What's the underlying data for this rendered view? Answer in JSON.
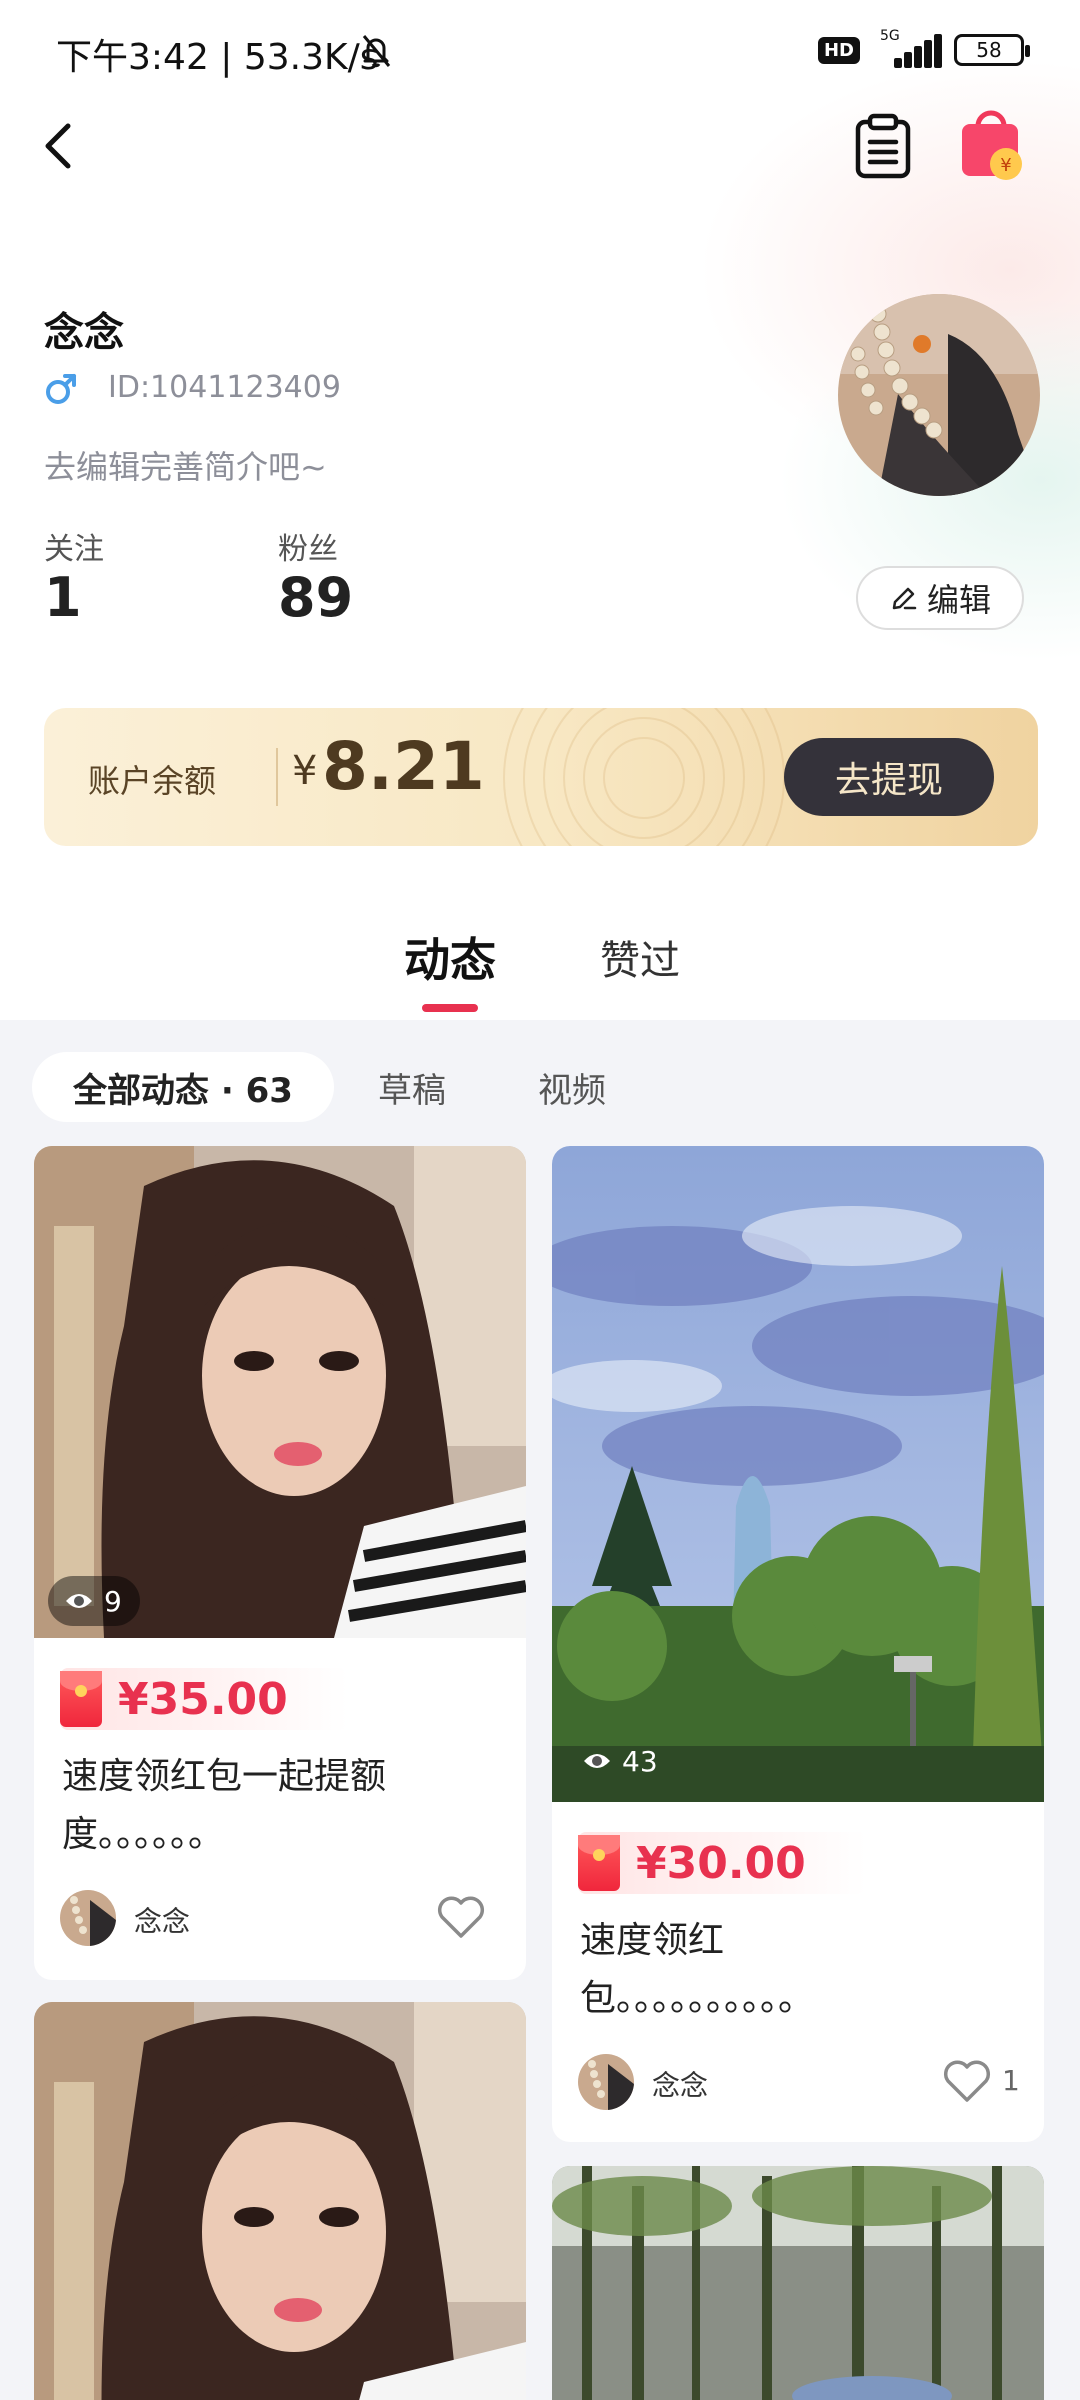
{
  "status_bar": {
    "time_speed": "下午3:42 | 53.3K/s",
    "hd": "HD",
    "network": "5G",
    "battery": "58"
  },
  "profile": {
    "nickname": "念念",
    "id_text": "ID:1041123409",
    "bio": "去编辑完善简介吧~",
    "following_label": "关注",
    "following_count": "1",
    "fans_label": "粉丝",
    "fans_count": "89",
    "edit_label": "编辑"
  },
  "balance": {
    "label": "账户余额",
    "currency": "¥",
    "amount": "8.21",
    "withdraw_label": "去提现"
  },
  "tabs": [
    {
      "label": "动态",
      "active": true
    },
    {
      "label": "赞过",
      "active": false
    }
  ],
  "filters": [
    {
      "label": "全部动态 · 63",
      "active": true
    },
    {
      "label": "草稿",
      "active": false
    },
    {
      "label": "视频",
      "active": false
    }
  ],
  "posts": [
    {
      "views": "9",
      "amount": "¥35.00",
      "text_line1": "速度领红包一起提额",
      "text_line2": "度。。。。。。",
      "author": "念念",
      "likes": ""
    },
    {
      "views": "43",
      "amount": "¥30.00",
      "text_line1": "速度领红",
      "text_line2": "包。。。。。。。。。。",
      "author": "念念",
      "likes": "1"
    }
  ],
  "icons": {
    "back": "chevron-left-icon",
    "clipboard": "clipboard-icon",
    "bag": "shopping-bag-icon",
    "gender": "male-icon",
    "edit": "pencil-icon",
    "eye": "eye-icon",
    "heart": "heart-icon",
    "bell": "bell-off-icon"
  },
  "colors": {
    "accent": "#e8314f",
    "withdraw_bg": "#34323a",
    "card_gold": "#f8e8c4"
  }
}
